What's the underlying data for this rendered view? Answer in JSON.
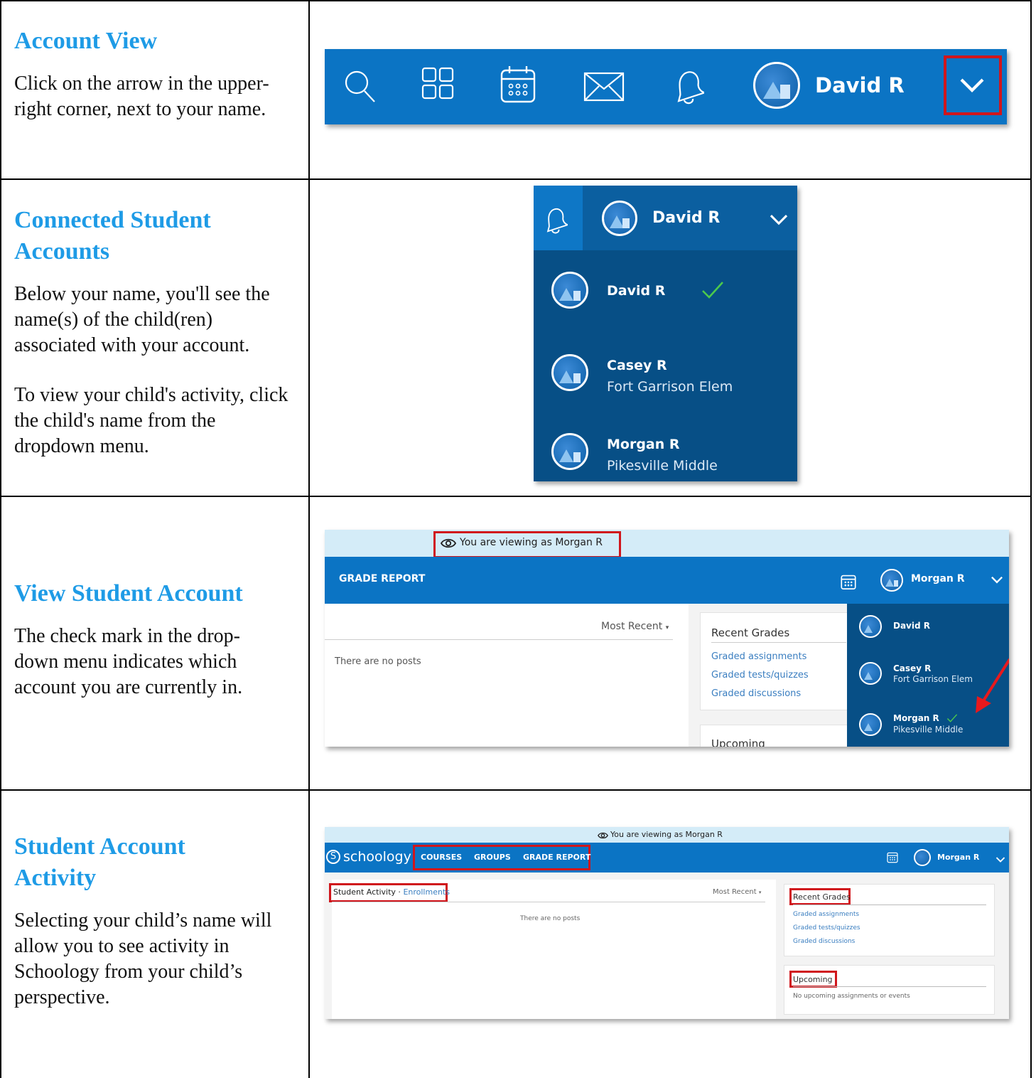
{
  "rows": [
    {
      "title": "Account View",
      "paragraphs": [
        "Click on the arrow in the upper-right corner, next to your name."
      ]
    },
    {
      "title": "Connected Student Accounts",
      "paragraphs": [
        "Below your name, you'll see the name(s) of the child(ren) associated with your account.",
        "To view your child's activity, click the child's name from the dropdown menu."
      ]
    },
    {
      "title": "View Student Account",
      "paragraphs": [
        "The check mark in the drop-down menu indicates which account you are currently in."
      ]
    },
    {
      "title": "Student Account Activity",
      "paragraphs": [
        "Selecting your child’s name will allow you to see activity in Schoology from your child’s perspective."
      ]
    }
  ],
  "topbar": {
    "user_name": "David R",
    "icons": [
      "search-icon",
      "grid-icon",
      "calendar-icon",
      "mail-icon",
      "bell-icon",
      "avatar",
      "chevron-down-icon"
    ],
    "bg_color": "#0b74c4",
    "highlight_color": "#d0161c"
  },
  "dropdown": {
    "header_name": "David R",
    "accounts": [
      {
        "name": "David R",
        "school": "",
        "checked": true
      },
      {
        "name": "Casey R",
        "school": "Fort Garrison Elem",
        "checked": false
      },
      {
        "name": "Morgan R",
        "school": "Pikesville Middle",
        "checked": false
      }
    ],
    "check_color": "#4cc94c"
  },
  "grade_view": {
    "viewing_banner": "You are viewing as Morgan R",
    "page_title": "GRADE REPORT",
    "user_name": "Morgan R",
    "sort_label": "Most Recent",
    "empty_text": "There are no posts",
    "recent_grades_title": "Recent Grades",
    "recent_links": [
      "Graded assignments",
      "Graded tests/quizzes",
      "Graded discussions"
    ],
    "upcoming_title": "Upcoming",
    "accounts": [
      {
        "name": "David R",
        "school": ""
      },
      {
        "name": "Casey R",
        "school": "Fort Garrison Elem"
      },
      {
        "name": "Morgan R",
        "school": "Pikesville Middle"
      }
    ]
  },
  "activity_view": {
    "viewing_banner": "You are viewing as Morgan R",
    "logo": "schoology",
    "nav": [
      "COURSES",
      "GROUPS",
      "GRADE REPORT"
    ],
    "user_name": "Morgan R",
    "activity_label": "Student Activity",
    "enrollments_label": "Enrollments",
    "sort_label": "Most Recent",
    "empty_text": "There are no posts",
    "recent_grades_title": "Recent Grades",
    "recent_links": [
      "Graded assignments",
      "Graded tests/quizzes",
      "Graded discussions"
    ],
    "upcoming_title": "Upcoming",
    "upcoming_empty": "No upcoming assignments or events"
  }
}
